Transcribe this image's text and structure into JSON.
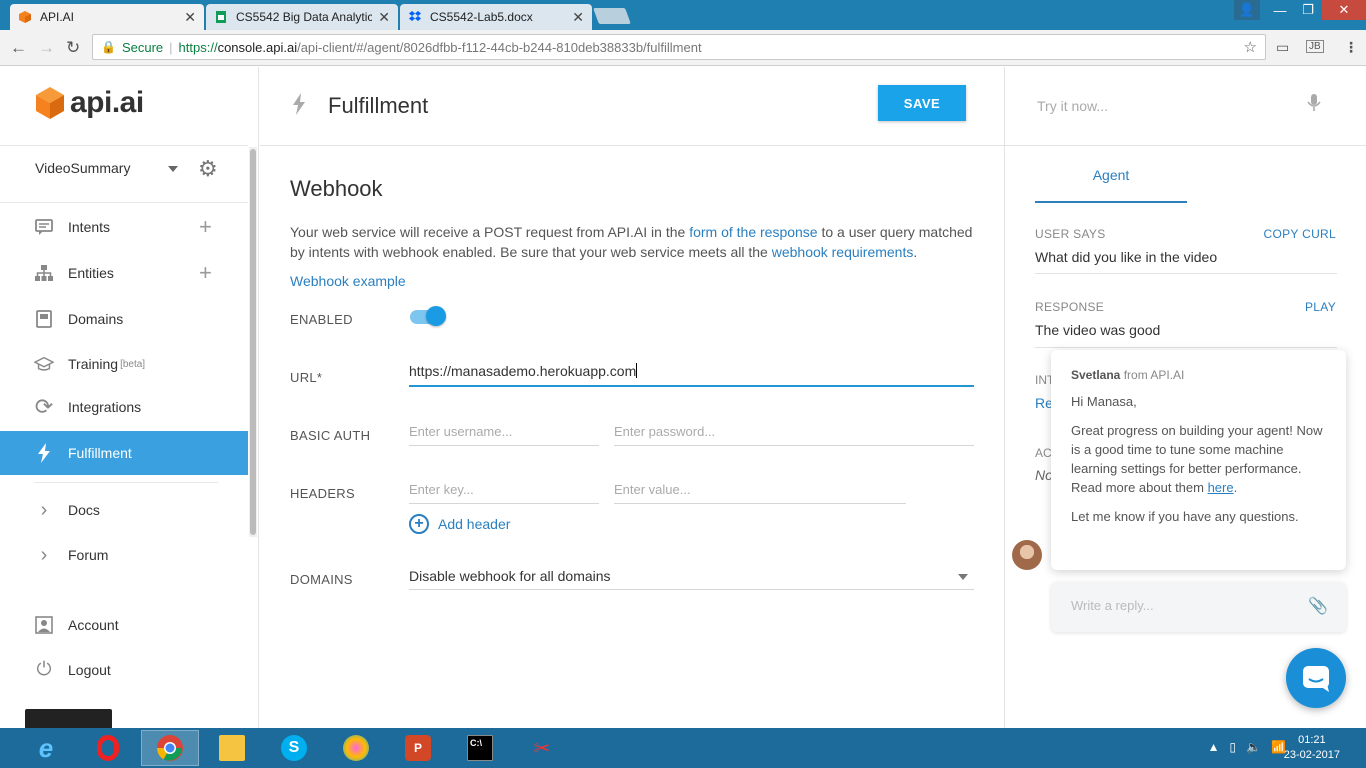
{
  "browser": {
    "tabs": [
      {
        "title": "API.AI",
        "favicon": "api-ai-cube-icon",
        "color": "#f5821f"
      },
      {
        "title": "CS5542 Big Data Analytic",
        "favicon": "sheets-icon",
        "color": "#0f9d58"
      },
      {
        "title": "CS5542-Lab5.docx",
        "favicon": "dropbox-icon",
        "color": "#0061fe"
      }
    ],
    "address": {
      "secure_label": "Secure",
      "url_proto": "https://",
      "url_host": "console.api.ai",
      "url_path": "/api-client/#/agent/8026dfbb-f112-44cb-b244-810deb38833b/fulfillment"
    }
  },
  "sidebar": {
    "logo_text": "api.ai",
    "agent_name": "VideoSummary",
    "items": [
      {
        "label": "Intents",
        "icon": "chat-bubble-icon",
        "plus": true
      },
      {
        "label": "Entities",
        "icon": "sitemap-icon",
        "plus": true
      },
      {
        "label": "Domains",
        "icon": "book-icon",
        "plus": false
      },
      {
        "label": "Training",
        "icon": "graduation-cap-icon",
        "plus": false,
        "badge": "[beta]"
      },
      {
        "label": "Integrations",
        "icon": "refresh-icon",
        "plus": false
      },
      {
        "label": "Fulfillment",
        "icon": "bolt-icon",
        "plus": false,
        "active": true
      },
      {
        "label": "Docs",
        "icon": "chevron-right-icon"
      },
      {
        "label": "Forum",
        "icon": "chevron-right-icon"
      },
      {
        "label": "Account",
        "icon": "account-icon"
      },
      {
        "label": "Logout",
        "icon": "power-icon"
      }
    ]
  },
  "main": {
    "title": "Fulfillment",
    "save_label": "SAVE",
    "webhook_title": "Webhook",
    "desc_1": "Your web service will receive a POST request from API.AI in the ",
    "desc_link_1": "form of the response",
    "desc_2": " to a user query matched by intents with webhook enabled. Be sure that your web service meets all the ",
    "desc_link_2": "webhook requirements",
    "desc_3": ".",
    "webhook_example": "Webhook example",
    "enabled_label": "ENABLED",
    "url_label": "URL*",
    "url_value": "https://manasademo.herokuapp.com",
    "basic_auth_label": "BASIC AUTH",
    "username_placeholder": "Enter username...",
    "password_placeholder": "Enter password...",
    "headers_label": "HEADERS",
    "key_placeholder": "Enter key...",
    "value_placeholder": "Enter value...",
    "add_header": "Add header",
    "domains_label": "DOMAINS",
    "domains_value": "Disable webhook for all domains"
  },
  "test_panel": {
    "try_placeholder": "Try it now...",
    "agent_tab": "Agent",
    "user_says_label": "USER SAYS",
    "copy_curl": "COPY CURL",
    "user_says_value": "What did you like in the video",
    "response_label": "RESPONSE",
    "play": "PLAY",
    "response_value": "The video was good",
    "partial_1": "INT",
    "partial_2": "Re",
    "partial_3": "AC",
    "partial_4": "No"
  },
  "chat": {
    "sender": "Svetlana",
    "from": " from API.AI",
    "greeting": "Hi Manasa,",
    "body": "Great progress on building your agent! Now is a good time to tune some machine learning settings for better performance. Read more about them ",
    "link": "here",
    "body_end": ".",
    "closing": "Let me know if you have any questions.",
    "reply_placeholder": "Write a reply..."
  },
  "taskbar": {
    "time": "01:21",
    "date": "23-02-2017"
  }
}
